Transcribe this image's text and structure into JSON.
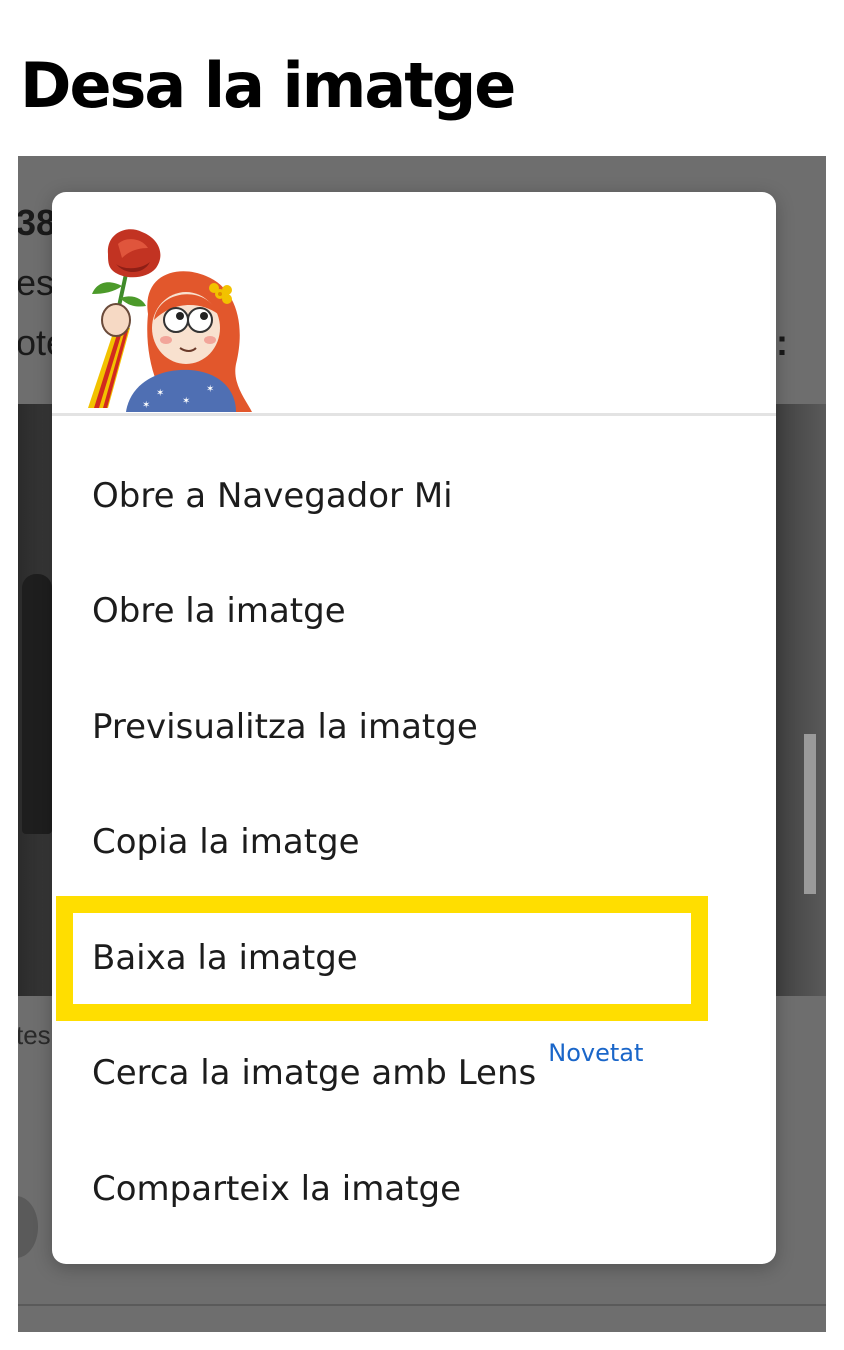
{
  "page": {
    "title": "Desa la imatge"
  },
  "background": {
    "fragments": [
      "38",
      "es",
      "ote",
      ":",
      "tes"
    ]
  },
  "dialog": {
    "preview": {
      "icon": "girl-with-rose-illustration"
    },
    "menu_items": [
      {
        "label": "Obre a Navegador Mi"
      },
      {
        "label": "Obre la imatge"
      },
      {
        "label": "Previsualitza la imatge"
      },
      {
        "label": "Copia la imatge"
      },
      {
        "label": "Baixa la imatge",
        "highlighted": true
      },
      {
        "label": "Cerca la imatge amb Lens",
        "badge": "Novetat"
      },
      {
        "label": "Comparteix la imatge"
      }
    ]
  },
  "colors": {
    "highlight": "#ffde00",
    "badge": "#1a66c9",
    "overlay": "#6e6e6e"
  }
}
